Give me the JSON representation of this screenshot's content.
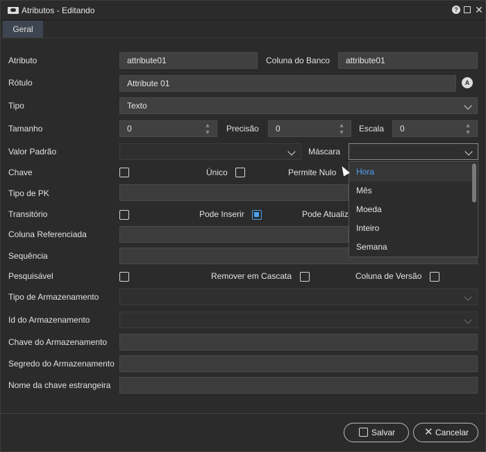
{
  "window": {
    "title": "Atributos - Editando"
  },
  "tabs": [
    {
      "label": "Geral"
    }
  ],
  "form": {
    "atributo": {
      "label": "Atributo",
      "value": "attribute01"
    },
    "coluna_banco": {
      "label": "Coluna do Banco",
      "value": "attribute01"
    },
    "rotulo": {
      "label": "Rótulo",
      "value": "Attribute 01"
    },
    "tipo": {
      "label": "Tipo",
      "value": "Texto"
    },
    "tamanho": {
      "label": "Tamanho",
      "value": "0"
    },
    "precisao": {
      "label": "Precisão",
      "value": "0"
    },
    "escala": {
      "label": "Escala",
      "value": "0"
    },
    "valor_padrao": {
      "label": "Valor Padrão",
      "value": ""
    },
    "mascara": {
      "label": "Máscara",
      "value": ""
    },
    "chave": {
      "label": "Chave",
      "checked": false
    },
    "unico": {
      "label": "Único",
      "checked": false
    },
    "permite_nulo": {
      "label": "Permite Nulo"
    },
    "tipo_pk": {
      "label": "Tipo de PK",
      "value": ""
    },
    "transitorio": {
      "label": "Transitório",
      "checked": false
    },
    "pode_inserir": {
      "label": "Pode Inserir",
      "checked": true
    },
    "pode_atualizar": {
      "label": "Pode Atualiz"
    },
    "coluna_referenciada": {
      "label": "Coluna Referenciada",
      "value": ""
    },
    "sequencia": {
      "label": "Sequência",
      "value": ""
    },
    "pesquisavel": {
      "label": "Pesquisável",
      "checked": false
    },
    "remover_cascata": {
      "label": "Remover em Cascata",
      "checked": false
    },
    "coluna_versao": {
      "label": "Coluna de Versão",
      "checked": false
    },
    "tipo_armazenamento": {
      "label": "Tipo de Armazenamento",
      "value": ""
    },
    "id_armazenamento": {
      "label": "Id do Armazenamento",
      "value": ""
    },
    "chave_armazenamento": {
      "label": "Chave do Armazenamento",
      "value": ""
    },
    "segredo_armazenamento": {
      "label": "Segredo do Armazenamento",
      "value": ""
    },
    "nome_chave_estrangeira": {
      "label": "Nome da chave estrangeira",
      "value": ""
    }
  },
  "mascara_dropdown": {
    "options": [
      "Hora",
      "Mês",
      "Moeda",
      "Inteiro",
      "Semana"
    ],
    "highlighted": "Hora"
  },
  "buttons": {
    "save": "Salvar",
    "cancel": "Cancelar"
  },
  "colors": {
    "accent": "#4da3f5",
    "background": "#2b2b2b",
    "field": "#404040"
  }
}
